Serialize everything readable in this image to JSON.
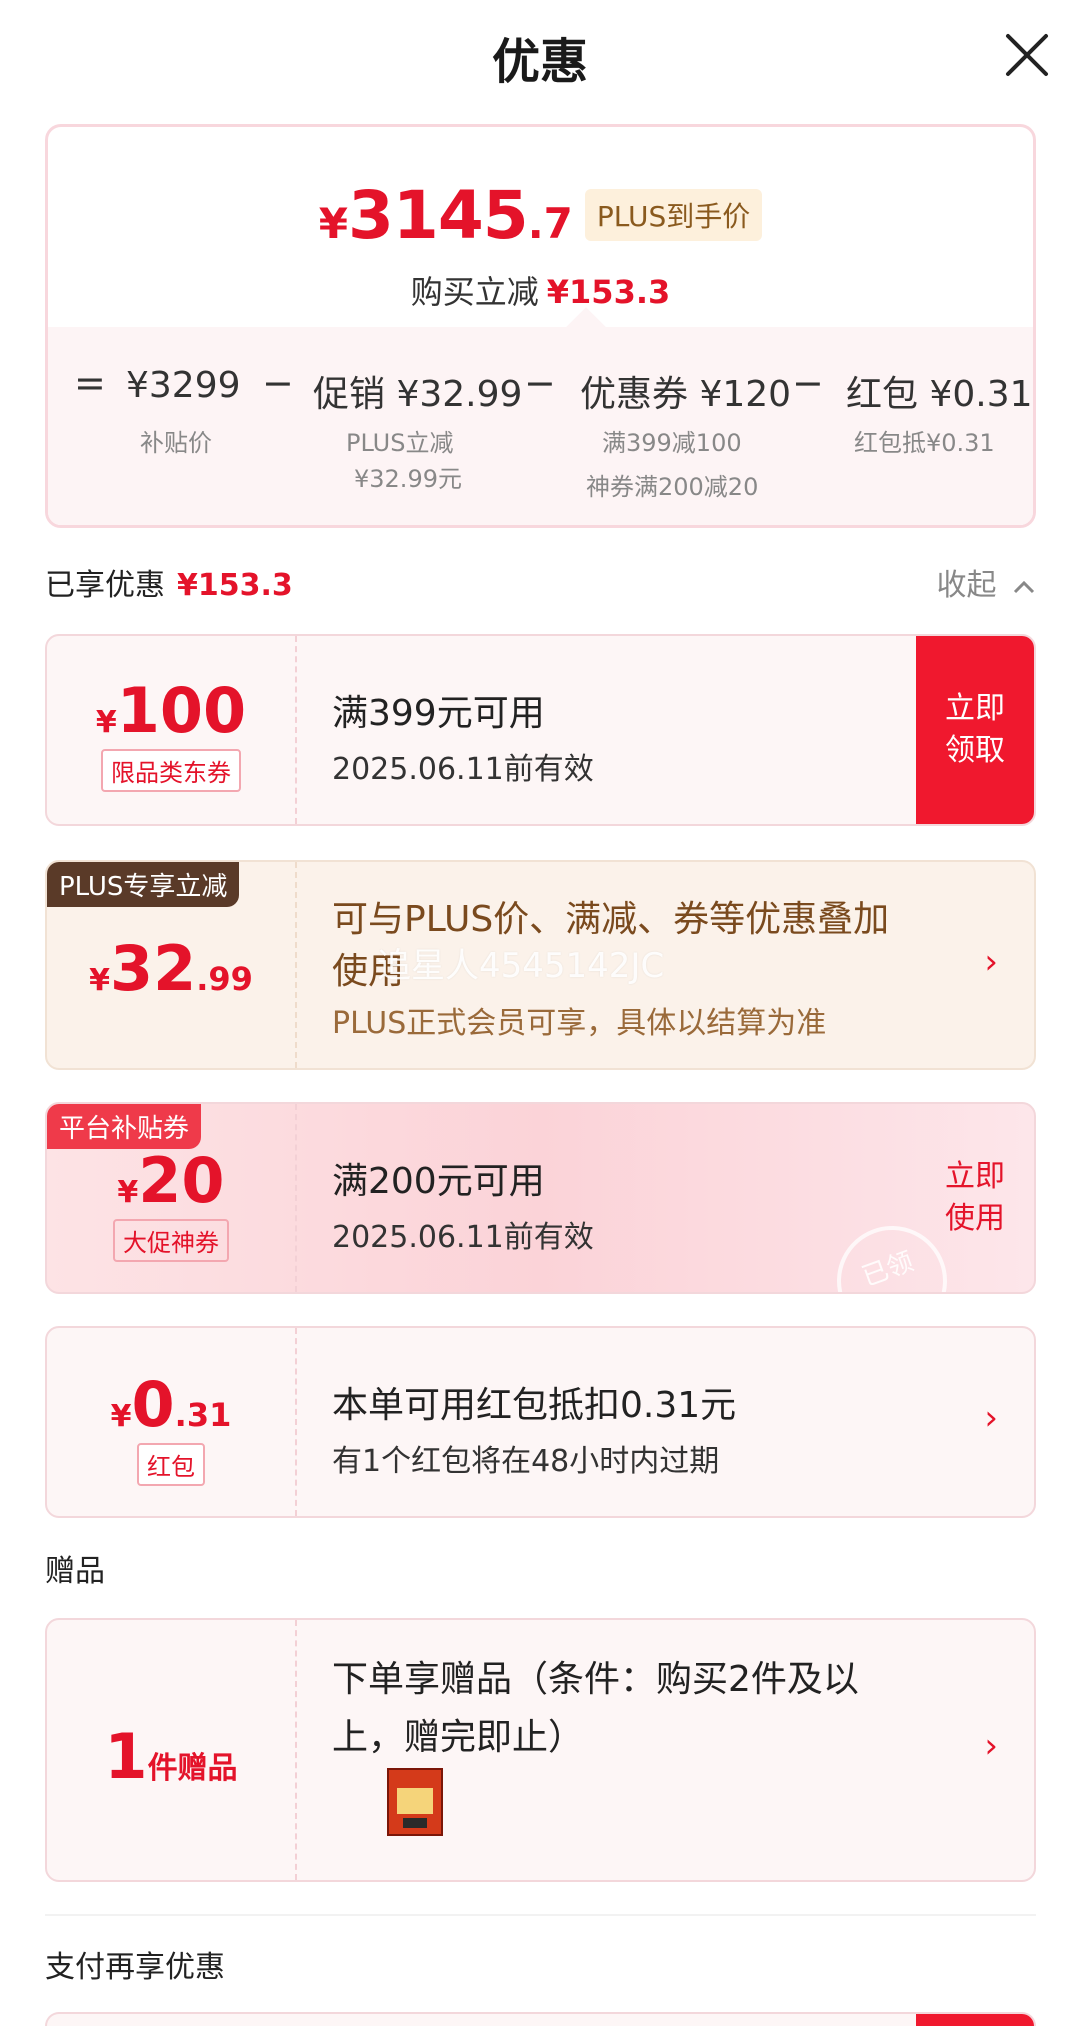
{
  "header": {
    "title": "优惠"
  },
  "summary": {
    "price_yen": "¥",
    "price_int": "3145",
    "price_dec": ".7",
    "plus_tag": "PLUS到手价",
    "reduce_label": "购买立减",
    "reduce_amount": "¥153.3",
    "formula": {
      "eq": "=",
      "base": "¥3299",
      "base_sub": "补贴价",
      "op1": "−",
      "promo": "促销 ¥32.99",
      "promo_sub1": "PLUS立减",
      "promo_sub2": "¥32.99元",
      "op2": "−",
      "coupon": "优惠券 ¥120",
      "coupon_sub1": "满399减100",
      "coupon_sub2": "神券满200减20",
      "op3": "−",
      "redpacket": "红包 ¥0.31",
      "redpacket_sub": "红包抵¥0.31"
    }
  },
  "enjoyed": {
    "label": "已享优惠",
    "amount": "¥153.3",
    "collapse": "收起"
  },
  "cards": {
    "coupon100": {
      "yen": "¥",
      "num": "100",
      "tag": "限品类东券",
      "line1": "满399元可用",
      "line2": "2025.06.11前有效",
      "cta1": "立即",
      "cta2": "领取"
    },
    "plus": {
      "corner": "PLUS专享立减",
      "yen": "¥",
      "num": "32",
      "dec": ".99",
      "line1a": "可与PLUS价、满减、券等优惠叠加",
      "line1b": "使用",
      "line2": "PLUS正式会员可享，具体以结算为准",
      "watermark": "追星人4545142JC"
    },
    "coupon20": {
      "corner": "平台补贴券",
      "yen": "¥",
      "num": "20",
      "tag": "大促神券",
      "line1": "满200元可用",
      "line2": "2025.06.11前有效",
      "cta1": "立即",
      "cta2": "使用",
      "stamp": "已领"
    },
    "redpacket": {
      "yen": "¥",
      "num": "0",
      "dec": ".31",
      "tag": "红包",
      "line1": "本单可用红包抵扣0.31元",
      "line2": "有1个红包将在48小时内过期"
    }
  },
  "gifts": {
    "section": "赠品",
    "count": "1",
    "unit": "件赠品",
    "line1": "下单享赠品（条件：购买2件及以",
    "line2": "上，赠完即止）"
  },
  "pay": {
    "section": "支付再享优惠"
  },
  "colors": {
    "accent_red": "#e4132a",
    "plus_gold": "#8a5a1e"
  },
  "icons": {
    "close": "close-icon",
    "chevron": "chevron-right-icon",
    "collapse": "chevron-up-icon"
  }
}
